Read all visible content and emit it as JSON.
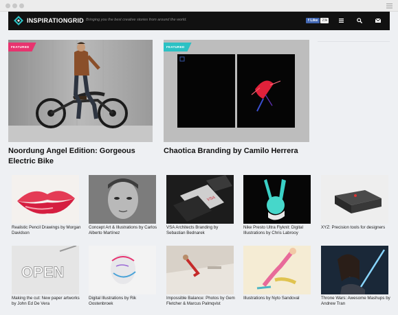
{
  "header": {
    "logo": "INSPIRATIONGRID",
    "tagline": "Bringing you the best creative stories from around the world.",
    "facebook_like": "Like",
    "facebook_count": "23k",
    "icons": [
      "menu-icon",
      "search-icon",
      "mail-icon"
    ]
  },
  "colors": {
    "accent_teal": "#2bc1c4",
    "accent_pink": "#e8336f",
    "nav_bg": "#111111"
  },
  "featured": [
    {
      "badge": "FEATURED",
      "title": "Noordung Angel Edition: Gorgeous Electric Bike"
    },
    {
      "badge": "FEATURED",
      "title": "Chaotica Branding by Camilo Herrera"
    }
  ],
  "grid": [
    {
      "caption": "Realistic Pencil Drawings by Morgan Davidson"
    },
    {
      "caption": "Concept Art & Illustrations by Carlos Alberto Martínez"
    },
    {
      "caption": "VSA Architects Branding by Sebastian Bednarek"
    },
    {
      "caption": "Nike Presto Ultra Flyknit: Digital Illustrations by Chris Labrooy"
    },
    {
      "caption": "XYZ: Precision tools for designers"
    },
    {
      "caption": "Making the cut: New paper artworks by John Ed De Vera"
    },
    {
      "caption": "Digital Illustrations by Rik Oostenbroek"
    },
    {
      "caption": "Impossible Balance: Photos by Gem Fletcher & Marcus Palmqvist"
    },
    {
      "caption": "Illustrations by Nyto Sandoval"
    },
    {
      "caption": "Throne Wars: Awesome Mashups by Andrew Tran"
    }
  ]
}
